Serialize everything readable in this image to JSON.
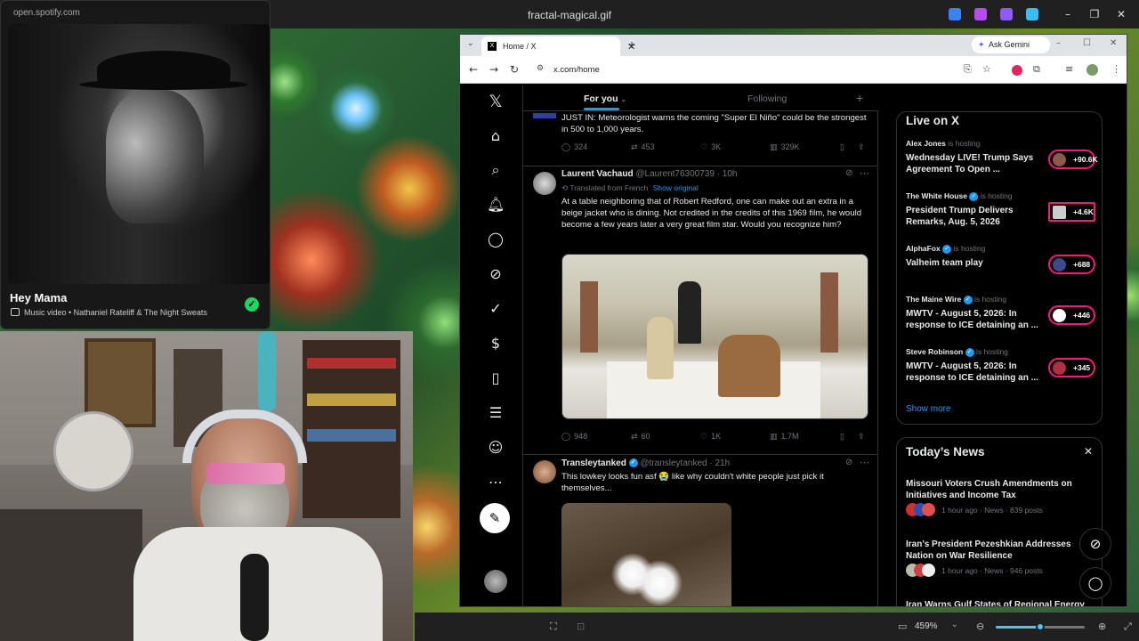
{
  "viewer": {
    "title": "fractal-magical.gif",
    "zoom": "459%",
    "zoom_level": 0.5
  },
  "spotify": {
    "url": "open.spotify.com",
    "song": "Hey Mama",
    "meta": "Music video • Nathaniel Rateliff & The Night Sweats"
  },
  "browser": {
    "tab_title": "Home / X",
    "ask_gemini": "Ask Gemini",
    "url": "x.com/home"
  },
  "x": {
    "tabs": {
      "for_you": "For you",
      "following": "Following"
    },
    "tweets": [
      {
        "text": "JUST IN: Meteorologist warns the coming \"Super El Niño\" could be the strongest in 500 to 1,000 years.",
        "replies": "324",
        "reposts": "453",
        "likes": "3K",
        "views": "329K"
      },
      {
        "name": "Laurent Vachaud",
        "handle": "@Laurent76300739 · 10h",
        "translated": "Translated from French",
        "show_original": "Show original",
        "text": "At a table neighboring that of Robert Redford, one can make out an extra in a beige jacket who is dining. Not credited in the credits of this 1969 film, he would become a few years later a very great film star. Would you recognize him?",
        "replies": "948",
        "reposts": "60",
        "likes": "1K",
        "views": "1.7M"
      },
      {
        "name": "Transleytanked",
        "handle": "@transleytanked · 21h",
        "text": "This lowkey looks fun asf 😭 like why couldn't white people just pick it themselves..."
      }
    ],
    "search_placeholder": "Search",
    "live": {
      "heading": "Live on X",
      "hosting": "is hosting",
      "items": [
        {
          "host": "Alex Jones",
          "title": "Wednesday LIVE! Trump Says Agreement To Open ...",
          "count": "+90.6K"
        },
        {
          "host": "The White House",
          "title": "President Trump Delivers Remarks, Aug. 5, 2026",
          "count": "+4.6K"
        },
        {
          "host": "AlphaFox",
          "title": "Valheim team play",
          "count": "+688"
        },
        {
          "host": "The Maine Wire",
          "title": "MWTV - August 5, 2026: In response to ICE detaining an ...",
          "count": "+446"
        },
        {
          "host": "Steve Robinson",
          "title": "MWTV - August 5, 2026: In response to ICE detaining an ...",
          "count": "+345"
        }
      ],
      "show_more": "Show more"
    },
    "news": {
      "heading": "Today’s News",
      "items": [
        {
          "title": "Missouri Voters Crush Amendments on Initiatives and Income Tax",
          "meta": "1 hour ago · News · 839 posts"
        },
        {
          "title": "Iran's President Pezeshkian Addresses Nation on War Resilience",
          "meta": "1 hour ago · News · 946 posts"
        },
        {
          "title": "Iran Warns Gulf States of Regional Energy"
        }
      ]
    }
  }
}
